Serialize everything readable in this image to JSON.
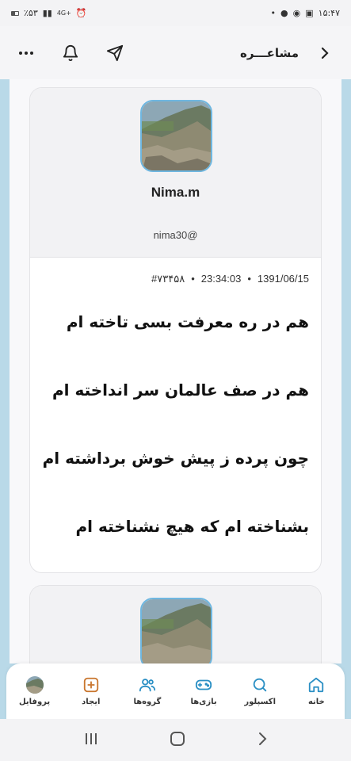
{
  "status_bar": {
    "time": "۱۵:۴۷",
    "battery": "٪۵۳",
    "network": "4G+"
  },
  "header": {
    "title": "مشاعـــره",
    "back_icon": "chevron-right-icon",
    "more_icon": "more-horizontal-icon",
    "bell_icon": "bell-icon",
    "send_icon": "send-icon"
  },
  "post": {
    "author_name": "Nima.m",
    "author_handle": "nima30@",
    "date": "1391/06/15",
    "time": "23:34:03",
    "id": "#۷۳۴۵۸",
    "verses": [
      "هم در ره معرفت بسی تاخته ام",
      "هم در صف عالمان سر انداخته ام",
      "چون پرده ز پیش خوش برداشته ام",
      "بشناخته ام که هیچ نشناخته ام"
    ]
  },
  "bottom_nav": {
    "items": [
      {
        "label": "خانه",
        "icon": "home-icon"
      },
      {
        "label": "اکسپلور",
        "icon": "search-icon"
      },
      {
        "label": "بازی‌ها",
        "icon": "gamepad-icon"
      },
      {
        "label": "گروه‌ها",
        "icon": "users-icon"
      },
      {
        "label": "ایجاد",
        "icon": "plus-square-icon"
      },
      {
        "label": "پروفایل",
        "icon": "avatar"
      }
    ]
  },
  "colors": {
    "accent": "#2a8fc4",
    "create": "#c9762e",
    "page_bg": "#b9d9e8"
  }
}
